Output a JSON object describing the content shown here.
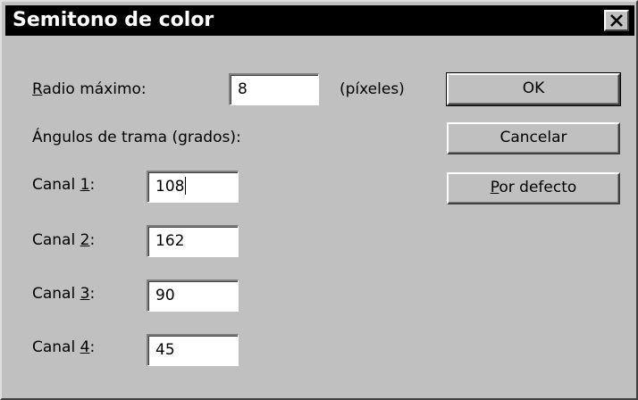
{
  "window": {
    "title": "Semitono de color",
    "close_glyph": "×"
  },
  "radius": {
    "label_mnemonic": "R",
    "label_rest": "adio máximo:",
    "value": "8",
    "unit": "(píxeles)"
  },
  "angles": {
    "heading": "Ángulos de trama (grados):",
    "channels": [
      {
        "prefix": "Canal ",
        "mnemonic": "1",
        "suffix": ":",
        "value": "108"
      },
      {
        "prefix": "Canal ",
        "mnemonic": "2",
        "suffix": ":",
        "value": "162"
      },
      {
        "prefix": "Canal ",
        "mnemonic": "3",
        "suffix": ":",
        "value": "90"
      },
      {
        "prefix": "Canal ",
        "mnemonic": "4",
        "suffix": ":",
        "value": "45"
      }
    ]
  },
  "buttons": {
    "ok": "OK",
    "cancel": "Cancelar",
    "defaults_mnemonic": "P",
    "defaults_rest": "or defecto"
  },
  "colors": {
    "dialog_face": "#c0c0c0",
    "titlebar": "#000000",
    "title_text": "#ffffff",
    "field_bg": "#ffffff"
  },
  "icons": {
    "close": "close-icon"
  }
}
